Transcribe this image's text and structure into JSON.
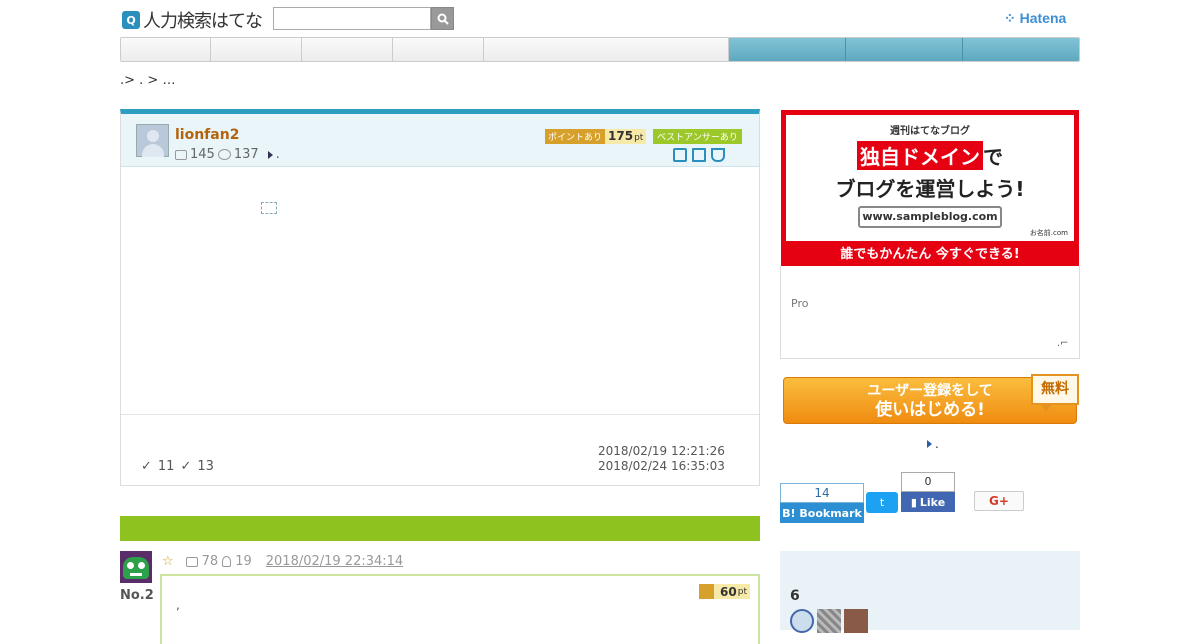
{
  "header": {
    "logo_icon": "Q",
    "logo_text": "人力検索はてな",
    "search_placeholder": "",
    "brand": "Hatena"
  },
  "nav": {
    "tabs": [
      "",
      "",
      "",
      "",
      "",
      "",
      ""
    ]
  },
  "breadcrumb": ".> . > …",
  "question": {
    "user": "lionfan2",
    "stat_questions": "145",
    "stat_answers": "137",
    "stat_suffix": ".",
    "point_label": "ポイントあり",
    "points": "175",
    "points_unit": "pt",
    "best_label": "ベストアンサーあり",
    "count_a": "11",
    "count_b": "13",
    "date_posted": "2018/02/19 12:21:26",
    "date_closed": "2018/02/24 16:35:03"
  },
  "answer": {
    "number": "No.2",
    "star": "☆",
    "stat_a": "78",
    "stat_b": "19",
    "date": "2018/02/19 22:34:14",
    "points": "60",
    "points_unit": "pt",
    "body_text": ","
  },
  "ad": {
    "small": "週刊はてなブログ",
    "highlight": "独自ドメイン",
    "line1_rest": "で",
    "line2": "ブログを運営しよう!",
    "url": "www.sampleblog.com",
    "sponsor": "お名前.com",
    "footer": "誰でもかんたん 今すぐできる!"
  },
  "pro": {
    "label": "Pro",
    "mark": ".⌐"
  },
  "signup": {
    "line1": "ユーザー登録をして",
    "line2": "使いはじめる!",
    "free": "無料"
  },
  "side_link": ".",
  "social": {
    "bookmark_count": "14",
    "bookmark_label": "B! Bookmark",
    "twitter_label": "t",
    "facebook_count": "0",
    "facebook_label": "Like",
    "gplus_label": "G+"
  },
  "sidepanel": {
    "count": "6"
  }
}
